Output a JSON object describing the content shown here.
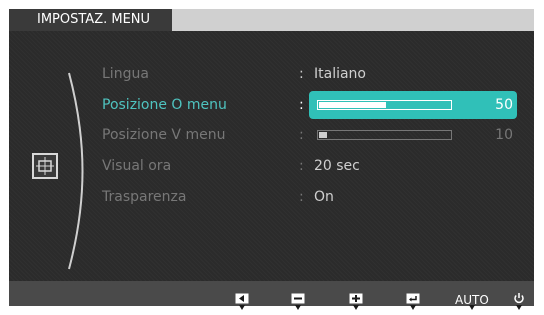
{
  "menu": {
    "title": "IMPOSTAZ. MENU"
  },
  "items": [
    {
      "label": "Lingua",
      "value": "Italiano"
    },
    {
      "label": "Posizione O menu",
      "value": "50",
      "level": 0.5
    },
    {
      "label": "Posizione V menu",
      "value": "10",
      "level": 0.1
    },
    {
      "label": "Visual ora",
      "value": "20 sec"
    },
    {
      "label": "Trasparenza",
      "value": "On"
    }
  ],
  "separator": ":",
  "side_icon": "menu-position-icon",
  "colors": {
    "accent": "#30c0b8",
    "panel": "#2b2b2b",
    "header_tab": "#3a3a3a"
  },
  "bottom_buttons": [
    {
      "icon": "left-arrow-icon"
    },
    {
      "icon": "minus-icon"
    },
    {
      "icon": "plus-icon"
    },
    {
      "icon": "enter-icon"
    },
    {
      "label": "AUTO"
    },
    {
      "icon": "power-icon"
    }
  ]
}
